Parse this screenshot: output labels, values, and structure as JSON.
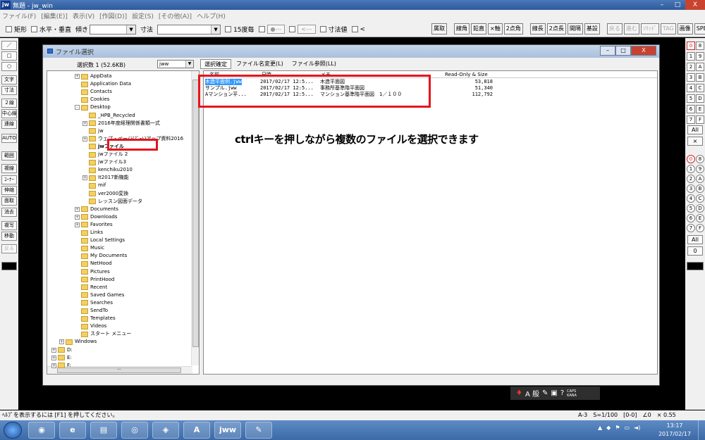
{
  "app": {
    "icon_label": "jw",
    "window_title": "無題 - jw_win",
    "window_buttons": [
      "–",
      "□",
      "X"
    ]
  },
  "menu": [
    "ファイル(F)",
    "[編集(E)]",
    "表示(V)",
    "[作図(D)]",
    "設定(S)",
    "[その他(A)]",
    "ヘルプ(H)"
  ],
  "toolbar": {
    "rect_label": "矩形",
    "hv_label": "水平・垂直",
    "slope_label": "傾き",
    "dim_label": "寸法",
    "deg15_label": "15度毎",
    "seg1": "●---",
    "seg2": "<---",
    "dimval_label": "寸法値",
    "lt_label": "<",
    "right_buttons": [
      "属取",
      "線角",
      "鉛直",
      "×軸",
      "2点角",
      "線長",
      "2点長",
      "間隔",
      "基設"
    ],
    "right_buttons_disabled": [
      "戻る",
      "進む",
      "ｿﾘｯﾄﾞ",
      "TAG"
    ],
    "right_buttons_end": [
      "画像",
      "SPEED"
    ]
  },
  "left_tools": [
    {
      "label": "／",
      "enabled": true
    },
    {
      "label": "□",
      "enabled": true
    },
    {
      "label": "○",
      "enabled": true
    },
    {
      "label": "文字",
      "enabled": true
    },
    {
      "label": "寸法",
      "enabled": true
    },
    {
      "label": "２線",
      "enabled": true
    },
    {
      "label": "中心線",
      "enabled": true
    },
    {
      "label": "連線",
      "enabled": true
    },
    {
      "label": "AUTO",
      "enabled": true
    },
    {
      "label": "範囲",
      "enabled": true
    },
    {
      "label": "複線",
      "enabled": true
    },
    {
      "label": "ｺｰﾅｰ",
      "enabled": true
    },
    {
      "label": "伸縮",
      "enabled": true
    },
    {
      "label": "面取",
      "enabled": true
    },
    {
      "label": "消去",
      "enabled": true
    },
    {
      "label": "複写",
      "enabled": true
    },
    {
      "label": "移動",
      "enabled": true
    },
    {
      "label": "戻る",
      "enabled": false
    }
  ],
  "right_tools": {
    "layer_pairs": [
      [
        "0",
        "8"
      ],
      [
        "1",
        "9"
      ],
      [
        "2",
        "A"
      ],
      [
        "3",
        "B"
      ],
      [
        "4",
        "C"
      ],
      [
        "5",
        "D"
      ],
      [
        "6",
        "E"
      ],
      [
        "7",
        "F"
      ]
    ],
    "all1": "All",
    "cross": "×",
    "group_pairs": [
      [
        "0",
        "8"
      ],
      [
        "1",
        "9"
      ],
      [
        "2",
        "A"
      ],
      [
        "3",
        "B"
      ],
      [
        "4",
        "C"
      ],
      [
        "5",
        "D"
      ],
      [
        "6",
        "E"
      ],
      [
        "7",
        "F"
      ]
    ],
    "all2": "All",
    "zero": "0"
  },
  "dialog": {
    "title": "ファイル選択",
    "window_buttons": [
      "–",
      "□",
      "X"
    ],
    "selection_count": "選択数 1 (52.6KB)",
    "ext_filter": "jww",
    "tabs": [
      "選択確定",
      "ファイル名変更(L)",
      "ファイル参照(LL)"
    ],
    "tree": [
      {
        "label": "AppData",
        "depth": 4,
        "expander": "+"
      },
      {
        "label": "Application Data",
        "depth": 4,
        "expander": ""
      },
      {
        "label": "Contacts",
        "depth": 4,
        "expander": ""
      },
      {
        "label": "Cookies",
        "depth": 4,
        "expander": ""
      },
      {
        "label": "Desktop",
        "depth": 4,
        "expander": "-"
      },
      {
        "label": "_HPB_Recycled",
        "depth": 5,
        "expander": ""
      },
      {
        "label": "2016年度経理関係書類一式",
        "depth": 5,
        "expander": "+"
      },
      {
        "label": "jw",
        "depth": 5,
        "expander": ""
      },
      {
        "label": "ウェブ・ページ(ｽﾞｰﾑ)アップ資料2016",
        "depth": 5,
        "expander": "+"
      },
      {
        "label": "jwファイル",
        "depth": 5,
        "expander": "",
        "selected": true
      },
      {
        "label": "jwファイル 2",
        "depth": 5,
        "expander": ""
      },
      {
        "label": "jwファイル3",
        "depth": 5,
        "expander": ""
      },
      {
        "label": "kenchiku2010",
        "depth": 5,
        "expander": ""
      },
      {
        "label": "It2017新機能",
        "depth": 5,
        "expander": "+"
      },
      {
        "label": "mif",
        "depth": 5,
        "expander": ""
      },
      {
        "label": "ver2000変換",
        "depth": 5,
        "expander": ""
      },
      {
        "label": "レッスン図面データ",
        "depth": 5,
        "expander": ""
      },
      {
        "label": "Documents",
        "depth": 4,
        "expander": "+"
      },
      {
        "label": "Downloads",
        "depth": 4,
        "expander": "+"
      },
      {
        "label": "Favorites",
        "depth": 4,
        "expander": "+"
      },
      {
        "label": "Links",
        "depth": 4,
        "expander": ""
      },
      {
        "label": "Local Settings",
        "depth": 4,
        "expander": ""
      },
      {
        "label": "Music",
        "depth": 4,
        "expander": ""
      },
      {
        "label": "My Documents",
        "depth": 4,
        "expander": ""
      },
      {
        "label": "NetHood",
        "depth": 4,
        "expander": ""
      },
      {
        "label": "Pictures",
        "depth": 4,
        "expander": ""
      },
      {
        "label": "PrintHood",
        "depth": 4,
        "expander": ""
      },
      {
        "label": "Recent",
        "depth": 4,
        "expander": ""
      },
      {
        "label": "Saved Games",
        "depth": 4,
        "expander": ""
      },
      {
        "label": "Searches",
        "depth": 4,
        "expander": ""
      },
      {
        "label": "SendTo",
        "depth": 4,
        "expander": ""
      },
      {
        "label": "Templates",
        "depth": 4,
        "expander": ""
      },
      {
        "label": "Videos",
        "depth": 4,
        "expander": ""
      },
      {
        "label": "スタート メニュー",
        "depth": 4,
        "expander": ""
      },
      {
        "label": "Windows",
        "depth": 2,
        "expander": "+"
      },
      {
        "label": "D:",
        "depth": 1,
        "expander": "+"
      },
      {
        "label": "E:",
        "depth": 1,
        "expander": "+"
      },
      {
        "label": "F:",
        "depth": 1,
        "expander": "+"
      }
    ],
    "file_headers": {
      "name": "名前",
      "date": "日時",
      "memo": "メモ",
      "size": "Read-Only & Size"
    },
    "files": [
      {
        "name": "木造平面例.jww",
        "date": "2017/02/17 12:5...",
        "memo": "木造平面図",
        "size": "53,818",
        "selected": true
      },
      {
        "name": "サンプル.jww",
        "date": "2017/02/17 12:5...",
        "memo": "事務所基準階平面図",
        "size": "51,340",
        "selected": false
      },
      {
        "name": "Aマンション平...",
        "date": "2017/02/17 12:5...",
        "memo": "マンション基準階平面図　1／１００",
        "size": "112,792",
        "selected": false
      }
    ],
    "annotation": "ctrlキーを押しながら複数のファイルを選択できます"
  },
  "ime": {
    "label": "A 般",
    "caps": "CAPS",
    "kana": "KANA"
  },
  "status": {
    "hint": "ﾍﾙﾌﾟを表示するには [F1] を押してください。",
    "paper": "A-3",
    "scale": "S=1/100",
    "layer": "[0-0]",
    "angle": "∠0",
    "zoom": "× 0.55"
  },
  "taskbar": {
    "apps": [
      "◉",
      "e",
      "▤",
      "◎",
      "◈",
      "A",
      "jww",
      "✎"
    ],
    "time": "13:17",
    "date": "2017/02/17"
  },
  "colors": {
    "annotation_red": "#e8141c",
    "selection_blue": "#3399ff"
  }
}
